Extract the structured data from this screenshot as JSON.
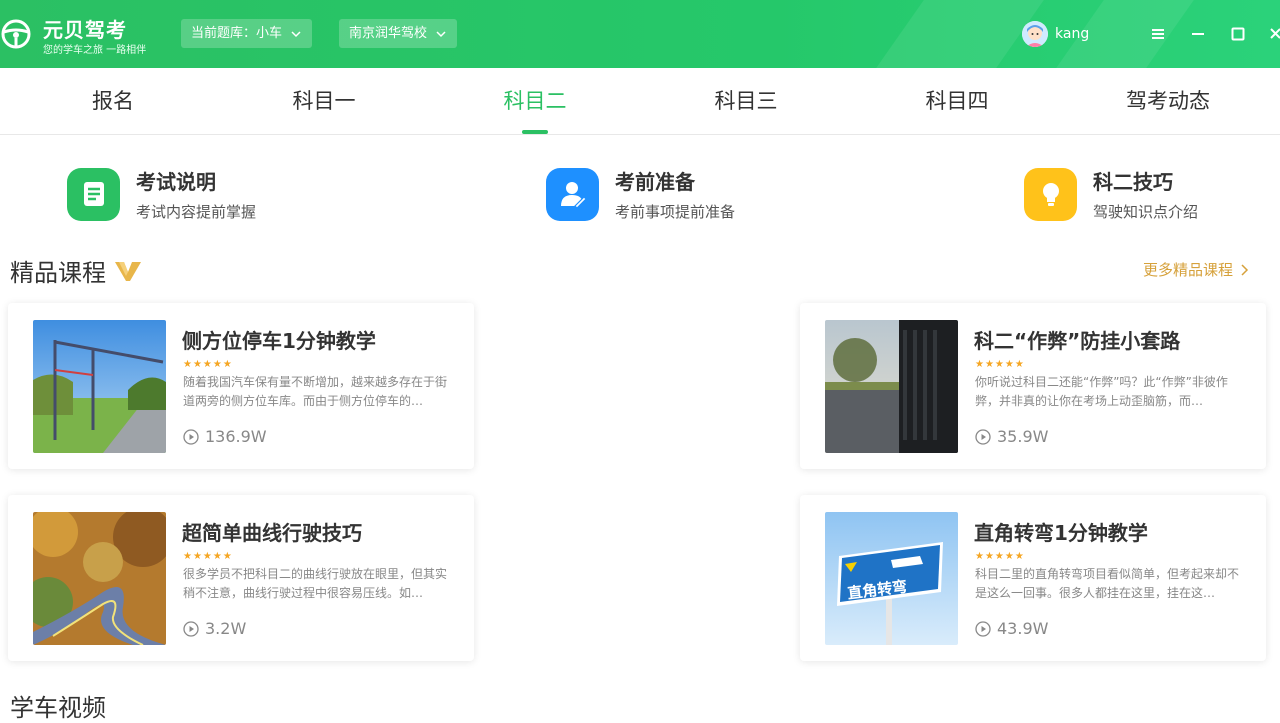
{
  "header": {
    "app_title": "元贝驾考",
    "app_subtitle": "您的学车之旅 一路相伴",
    "question_bank": "当前题库：小车",
    "school": "南京润华驾校",
    "username": "kang"
  },
  "tabs": [
    {
      "label": "报名"
    },
    {
      "label": "科目一"
    },
    {
      "label": "科目二",
      "active": true
    },
    {
      "label": "科目三"
    },
    {
      "label": "科目四"
    },
    {
      "label": "驾考动态"
    }
  ],
  "quick_entries": [
    {
      "title": "考试说明",
      "subtitle": "考试内容提前掌握",
      "icon": "document-icon",
      "color": "#2bc063"
    },
    {
      "title": "考前准备",
      "subtitle": "考前事项提前准备",
      "icon": "user-edit-icon",
      "color": "#1e90ff"
    },
    {
      "title": "科二技巧",
      "subtitle": "驾驶知识点介绍",
      "icon": "lightbulb-icon",
      "color": "#ffc21a"
    }
  ],
  "premium": {
    "title": "精品课程",
    "more": "更多精品课程",
    "courses": [
      {
        "title": "侧方位停车1分钟教学",
        "rating": "★★★★★",
        "desc": "随着我国汽车保有量不断增加，越来越多存在于街道两旁的侧方位车库。而由于侧方位停车的…",
        "plays": "136.9W"
      },
      {
        "title": "科二“作弊”防挂小套路",
        "rating": "★★★★★",
        "desc": "你听说过科目二还能“作弊”吗？此“作弊”非彼作弊，并非真的让你在考场上动歪脑筋，而…",
        "plays": "35.9W"
      },
      {
        "title": "超简单曲线行驶技巧",
        "rating": "★★★★★",
        "desc": "很多学员不把科目二的曲线行驶放在眼里，但其实稍不注意，曲线行驶过程中很容易压线。如…",
        "plays": "3.2W"
      },
      {
        "title": "直角转弯1分钟教学",
        "rating": "★★★★★",
        "desc": "科目二里的直角转弯项目看似简单，但考起来却不是这么一回事。很多人都挂在这里，挂在这…",
        "plays": "43.9W",
        "sign_text": "直角转弯"
      }
    ]
  },
  "videos": {
    "title": "学车视频"
  },
  "colors": {
    "brand": "#2bc063",
    "accent_gold": "#d6a13b"
  }
}
